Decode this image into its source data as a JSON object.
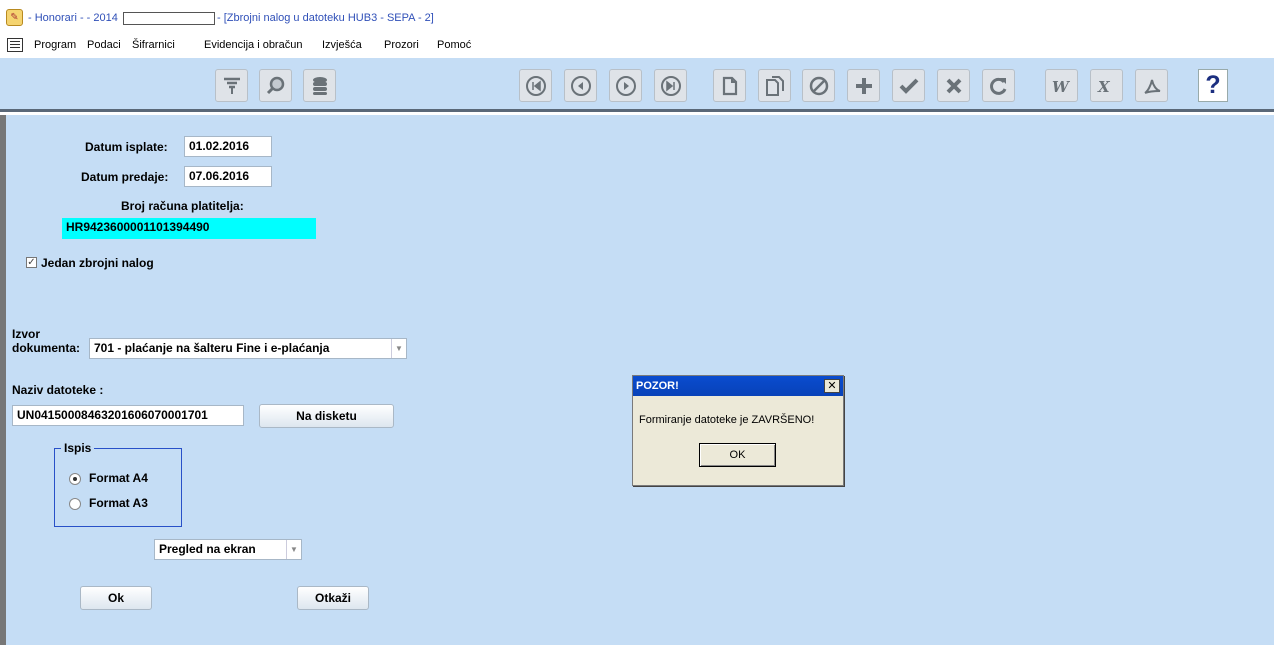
{
  "window": {
    "title_part1": "- Honorari - - 2014",
    "title_part2": "- [Zbrojni nalog u datoteku HUB3 - SEPA - 2]"
  },
  "menu": {
    "items": [
      "Program",
      "Podaci",
      "Šifrarnici",
      "Evidencija i obračun",
      "Izvješća",
      "Prozori",
      "Pomoć"
    ]
  },
  "toolbar": {
    "help_label": "?",
    "icons": [
      "filter-icon",
      "search-icon",
      "database-icon",
      "first-record-icon",
      "previous-record-icon",
      "next-record-icon",
      "last-record-icon",
      "new-document-icon",
      "copy-document-icon",
      "cancel-icon",
      "add-icon",
      "confirm-icon",
      "delete-icon",
      "refresh-icon",
      "word-export-icon",
      "excel-export-icon",
      "pdf-export-icon",
      "help-icon"
    ],
    "accent_color": "#1c2f80"
  },
  "form": {
    "datum_isplate_label": "Datum isplate:",
    "datum_isplate_value": "01.02.2016",
    "datum_predaje_label": "Datum predaje:",
    "datum_predaje_value": "07.06.2016",
    "broj_racuna_label": "Broj računa platitelja:",
    "broj_racuna_value": "HR9423600001101394490",
    "jedan_nalog_label": "Jedan zbrojni nalog",
    "jedan_nalog_checked": true,
    "izvor_label_line1": "Izvor",
    "izvor_label_line2": "dokumenta:",
    "izvor_value": "701 - plaćanje na šalteru Fine i e-plaćanja",
    "naziv_label": "Naziv datoteke :",
    "naziv_value": "UN0415000846320160607000170​1",
    "na_disketu_label": "Na disketu",
    "ispis_title": "Ispis",
    "format_a4_label": "Format A4",
    "format_a3_label": "Format A3",
    "format_selected": "Format A4",
    "pregled_value": "Pregled na ekran",
    "ok_label": "Ok",
    "otkazi_label": "Otkaži"
  },
  "dialog": {
    "title": "POZOR!",
    "close_label": "✕",
    "message": "Formiranje datoteke je ZAVRŠENO!",
    "ok_label": "OK"
  },
  "colors": {
    "background": "#c5ddf5",
    "highlight_field": "#00ffff",
    "dialog_title": "#0a4ccf"
  }
}
